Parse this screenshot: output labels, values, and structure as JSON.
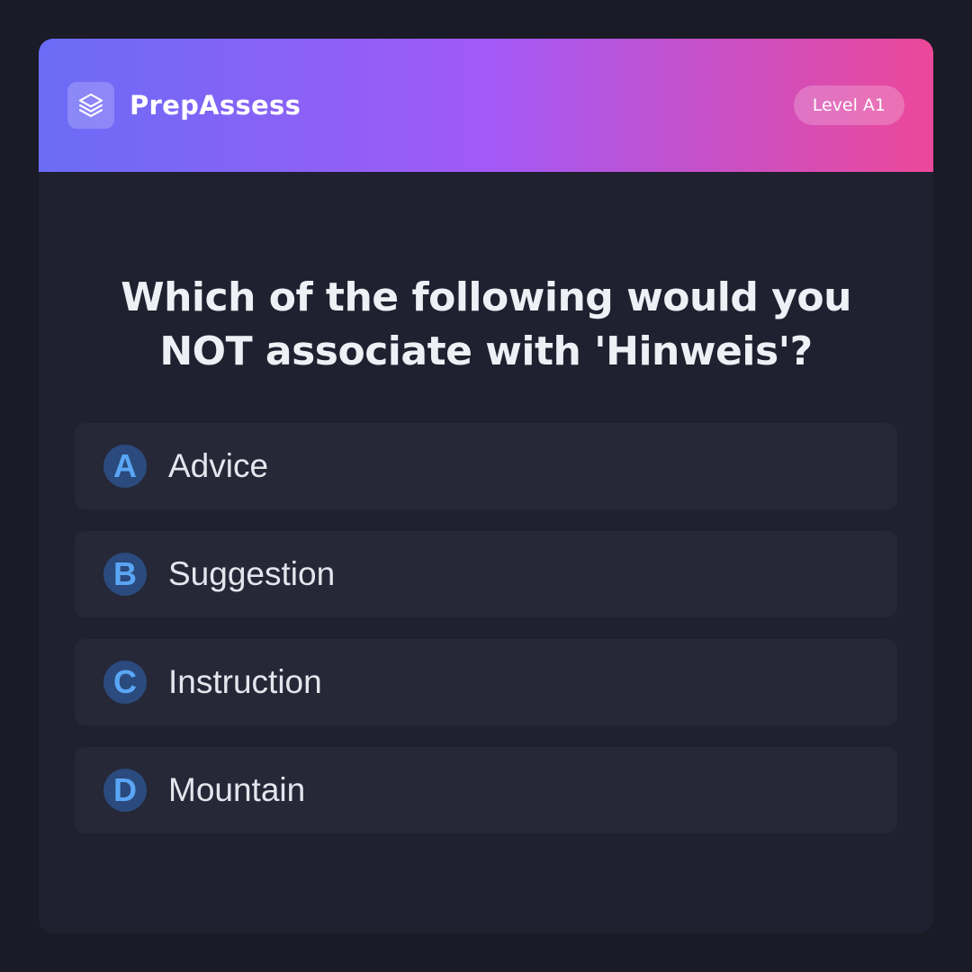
{
  "header": {
    "brand": "PrepAssess",
    "level_badge": "Level A1",
    "logo_icon": "layers-icon"
  },
  "colors": {
    "background": "#1a1b26",
    "card": "#1f2130",
    "option_bg": "#262837",
    "gradient": [
      "#6a6cf6",
      "#a259f7",
      "#ec4899"
    ],
    "letter_circle": "#2b4a7d",
    "letter_text": "#5aa6f5"
  },
  "quiz": {
    "question": "Which of the following would you NOT associate with 'Hinweis'?",
    "options": [
      {
        "letter": "A",
        "text": "Advice"
      },
      {
        "letter": "B",
        "text": "Suggestion"
      },
      {
        "letter": "C",
        "text": "Instruction"
      },
      {
        "letter": "D",
        "text": "Mountain"
      }
    ]
  }
}
